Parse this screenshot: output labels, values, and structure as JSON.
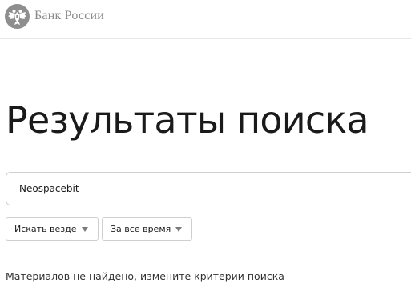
{
  "header": {
    "logo_text": "Банк России",
    "logo_icon": "double-headed-eagle-emblem"
  },
  "main": {
    "title": "Результаты поиска",
    "search": {
      "value": "Neospacebit"
    },
    "filters": {
      "scope": {
        "selected": "Искать везде",
        "icon": "chevron-down-icon"
      },
      "period": {
        "selected": "За все время",
        "icon": "chevron-down-icon"
      }
    },
    "message": "Материалов не найдено, измените критерии поиска"
  },
  "colors": {
    "text": "#1a1a1a",
    "logo_gray": "#8a8a8a",
    "border": "#cfcfcf"
  }
}
